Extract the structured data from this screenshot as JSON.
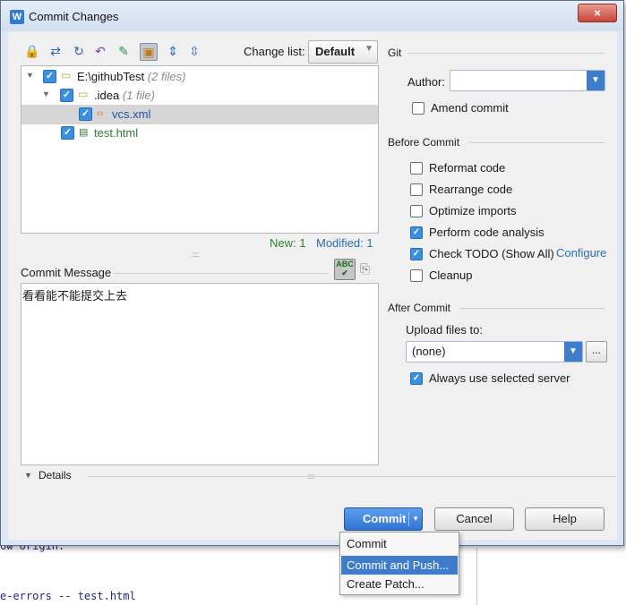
{
  "background": {
    "line1": "ow origin.",
    "line2": "e-errors -- test.html"
  },
  "dialog": {
    "title": "Commit Changes",
    "close_glyph": "×",
    "app_icon_letter": "W"
  },
  "toolbar": {
    "icons": [
      "lock-icon",
      "refresh-move-icon",
      "refresh-icon",
      "undo-icon",
      "edit-icon",
      "group-icon",
      "expand-all-icon",
      "collapse-all-icon"
    ],
    "changelist_label": "Change list:",
    "changelist_value": "Default"
  },
  "tree": {
    "root_label": "E:\\githubTest",
    "root_meta": "(2 files)",
    "idea_label": ".idea",
    "idea_meta": "(1 file)",
    "vcs_label": "vcs.xml",
    "test_label": "test.html"
  },
  "stats": {
    "new": "New: 1",
    "modified": "Modified: 1"
  },
  "commit_message": {
    "label": "Commit Message",
    "text": "看看能不能提交上去",
    "spell_glyph": "ABC"
  },
  "details": {
    "label": "Details"
  },
  "git": {
    "section": "Git",
    "author_label": "Author:",
    "author_value": "",
    "amend_label": "Amend commit"
  },
  "before_commit": {
    "section": "Before Commit",
    "options": [
      {
        "label": "Reformat code",
        "checked": false
      },
      {
        "label": "Rearrange code",
        "checked": false
      },
      {
        "label": "Optimize imports",
        "checked": false
      },
      {
        "label": "Perform code analysis",
        "checked": true
      },
      {
        "label": "Check TODO (Show All)",
        "checked": true
      },
      {
        "label": "Cleanup",
        "checked": false
      }
    ],
    "configure_link": "Configure"
  },
  "after_commit": {
    "section": "After Commit",
    "upload_label": "Upload files to:",
    "server_value": "(none)",
    "browse_label": "...",
    "always_label": "Always use selected server"
  },
  "buttons": {
    "commit": "Commit",
    "cancel": "Cancel",
    "help": "Help"
  },
  "menu": {
    "items": [
      "Commit",
      "Commit and Push...",
      "Create Patch..."
    ]
  },
  "colors": {
    "accent": "#3d7dcb",
    "new_green": "#2e7d32",
    "modified_blue": "#2b6fb5"
  }
}
